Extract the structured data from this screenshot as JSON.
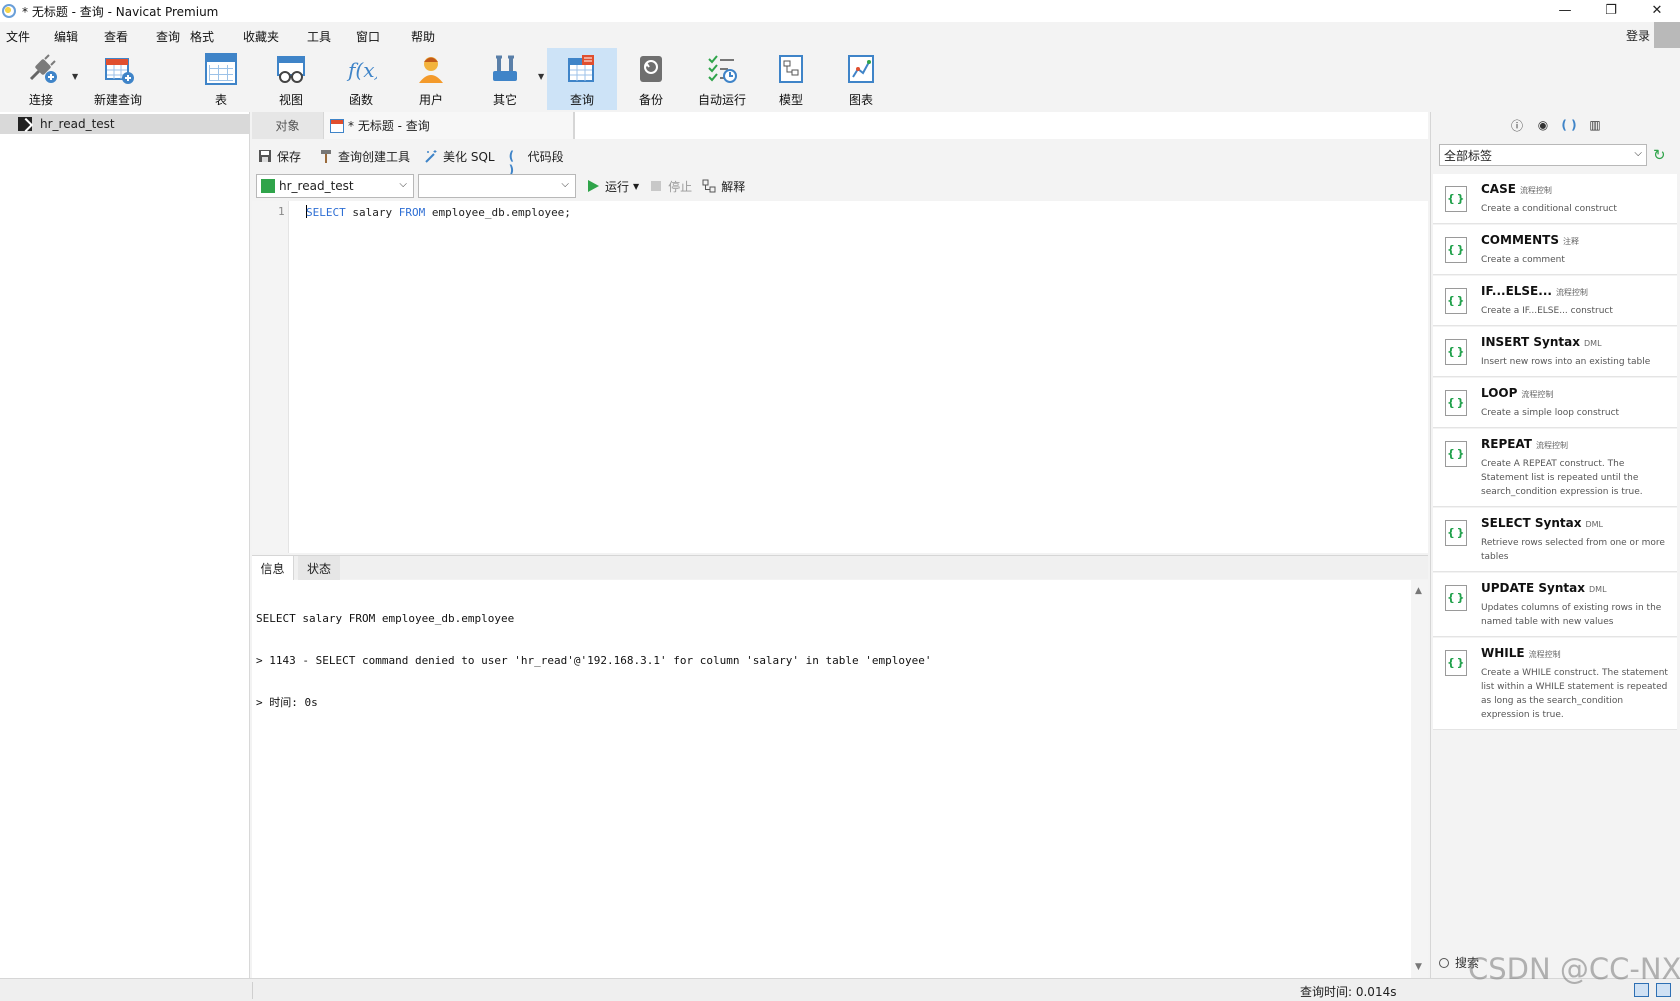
{
  "window": {
    "title": "* 无标题 - 查询 - Navicat Premium",
    "minimize": "—",
    "restore": "❐",
    "close": "✕"
  },
  "menu": {
    "items": [
      "文件",
      "编辑",
      "查看",
      "查询",
      "格式",
      "收藏夹",
      "工具",
      "窗口",
      "帮助"
    ],
    "login": "登录"
  },
  "toolbar": {
    "connect": "连接",
    "new_query": "新建查询",
    "table": "表",
    "view": "视图",
    "function": "函数",
    "user": "用户",
    "other": "其它",
    "query": "查询",
    "backup": "备份",
    "automation": "自动运行",
    "model": "模型",
    "chart": "图表"
  },
  "navigator": {
    "connection": "hr_read_test"
  },
  "tabs": {
    "objects": "对象",
    "query_tab": "* 无标题 - 查询"
  },
  "query_toolbar": {
    "save": "保存",
    "query_builder": "查询创建工具",
    "beautify": "美化 SQL",
    "snippet": "代码段"
  },
  "selectors": {
    "connection": "hr_read_test",
    "database": "",
    "run": "运行",
    "stop": "停止",
    "explain": "解释"
  },
  "editor": {
    "line_number": "1",
    "kw_select": "SELECT",
    "col": " salary ",
    "kw_from": "FROM",
    "rest": " employee_db.employee;"
  },
  "result_tabs": {
    "info": "信息",
    "status": "状态"
  },
  "messages": {
    "line1": "SELECT salary FROM employee_db.employee",
    "line2": "> 1143 - SELECT command denied to user 'hr_read'@'192.168.3.1' for column 'salary' in table 'employee'",
    "line3": "> 时间: 0s"
  },
  "right_panel": {
    "filter": "全部标签",
    "search": "搜索",
    "snippets": [
      {
        "name": "CASE",
        "tag": "流程控制",
        "desc": "Create a conditional construct"
      },
      {
        "name": "COMMENTS",
        "tag": "注释",
        "desc": "Create a comment"
      },
      {
        "name": "IF...ELSE...",
        "tag": "流程控制",
        "desc": "Create a IF...ELSE... construct"
      },
      {
        "name": "INSERT Syntax",
        "tag": "DML",
        "desc": "Insert new rows into an existing table"
      },
      {
        "name": "LOOP",
        "tag": "流程控制",
        "desc": "Create a simple loop construct"
      },
      {
        "name": "REPEAT",
        "tag": "流程控制",
        "desc": "Create A REPEAT construct. The Statement list is repeated until the search_condition expression is true."
      },
      {
        "name": "SELECT Syntax",
        "tag": "DML",
        "desc": "Retrieve rows selected from one or more tables"
      },
      {
        "name": "UPDATE Syntax",
        "tag": "DML",
        "desc": "Updates columns of existing rows in the named table with new values"
      },
      {
        "name": "WHILE",
        "tag": "流程控制",
        "desc": "Create a WHILE construct. The statement list within a WHILE statement is repeated as long as the search_condition expression is true."
      }
    ]
  },
  "status": {
    "query_time": "查询时间: 0.014s"
  },
  "watermark": "CSDN @CC-NX",
  "colors": {
    "accent": "#3f84c8",
    "keyword": "#2f6fd4",
    "active_tool": "#cde3f7",
    "run_green": "#2fa44a"
  }
}
